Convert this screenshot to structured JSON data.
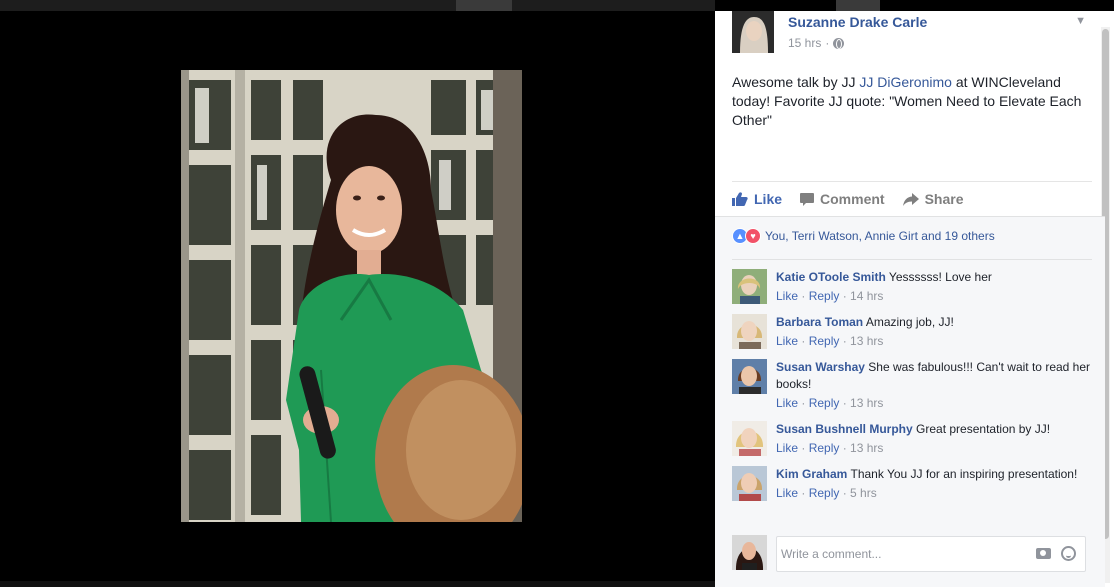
{
  "post": {
    "author": "Suzanne Drake Carle",
    "time": "15 hrs",
    "separator": "·",
    "text_before": "Awesome talk by JJ ",
    "mention": "JJ DiGeronimo",
    "text_after": " at WINCleveland today! Favorite JJ quote: \"Women Need to Elevate Each Other\""
  },
  "actions": {
    "like": "Like",
    "comment": "Comment",
    "share": "Share"
  },
  "reactions": {
    "summary": "You, Terri Watson, Annie Girt and 19 others"
  },
  "comments": [
    {
      "name": "Katie OToole Smith",
      "text": "Yessssss! Love her",
      "like": "Like",
      "reply": "Reply",
      "time": "14 hrs"
    },
    {
      "name": "Barbara Toman",
      "text": "Amazing job, JJ!",
      "like": "Like",
      "reply": "Reply",
      "time": "13 hrs"
    },
    {
      "name": "Susan Warshay",
      "text": "She was fabulous!!! Can't wait to read her books!",
      "like": "Like",
      "reply": "Reply",
      "time": "13 hrs"
    },
    {
      "name": "Susan Bushnell Murphy",
      "text": "Great presentation by JJ!",
      "like": "Like",
      "reply": "Reply",
      "time": "13 hrs"
    },
    {
      "name": "Kim Graham",
      "text": "Thank You JJ for an inspiring presentation!",
      "like": "Like",
      "reply": "Reply",
      "time": "5 hrs"
    }
  ],
  "composer": {
    "placeholder": "Write a comment..."
  },
  "colors": {
    "link": "#365899",
    "like_blue": "#4267b2",
    "muted": "#90949c",
    "love": "#f25268",
    "dress_green": "#1f9a55"
  }
}
